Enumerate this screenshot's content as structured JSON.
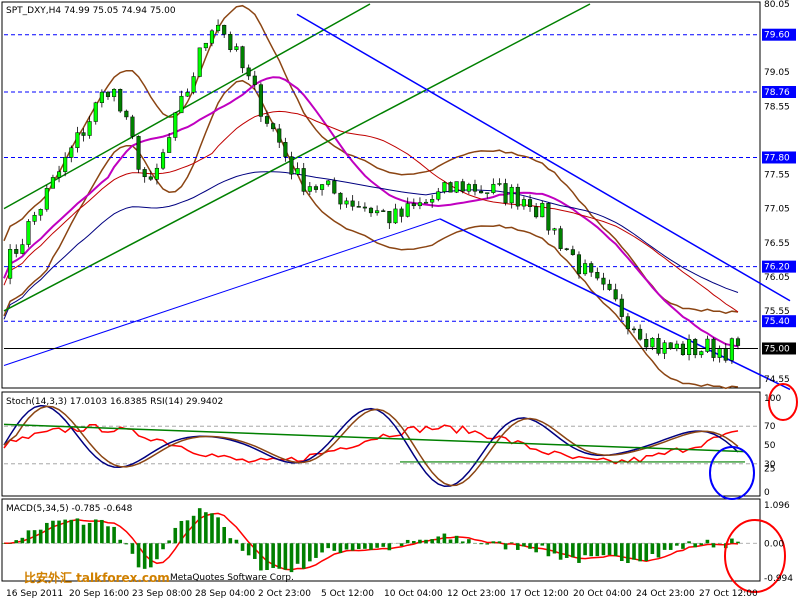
{
  "symbol_header": "SPT_DXY,H4  74.99 75.05 74.94 75.00",
  "stoch_header": "Stoch(14,3,3) 17.0103 16.8385  RSI(14) 29.9402",
  "macd_header": "MACD(5,34,5) -0.785 -0.648",
  "watermark": "比安外汇 talkforex.com",
  "footer_copyright": "MetaQuotes Software Corp.",
  "colors": {
    "background": "#ffffff",
    "bull_candle": "#00ff00",
    "bear_candle": "#008000",
    "dashed_level": "#0000ff",
    "level_tag": "#0000ff",
    "bollinger": "#8b4513",
    "ma_magenta": "#c000c0",
    "ma_red": "#c00000",
    "ma_navy": "#000080",
    "upper_channel": "#008000",
    "down_channel": "#0000ff",
    "stoch_main": "#000080",
    "stoch_signal": "#8b4513",
    "rsi": "#ff0000",
    "macd_hist": "#008000",
    "macd_signal": "#ff0000",
    "annotation_red": "#ff0000",
    "annotation_blue": "#0000ff",
    "watermark": "#d08000"
  },
  "price_axis": {
    "labels": [
      "80.05",
      "79.05",
      "78.55",
      "77.55",
      "77.05",
      "76.55",
      "76.05",
      "75.55",
      "74.55"
    ],
    "min": 74.45,
    "max": 80.05
  },
  "price_levels": [
    {
      "value": 79.6,
      "label": "79.60"
    },
    {
      "value": 78.76,
      "label": "78.76"
    },
    {
      "value": 77.8,
      "label": "77.80"
    },
    {
      "value": 76.2,
      "label": "76.20"
    },
    {
      "value": 75.4,
      "label": "75.40"
    },
    {
      "value": 75.0,
      "label": "75.00"
    }
  ],
  "stoch_axis": {
    "labels": [
      "100",
      "70",
      "50",
      "30",
      "25",
      "0"
    ],
    "levels": [
      100,
      70,
      50,
      30,
      25,
      0
    ]
  },
  "macd_axis": {
    "labels": [
      "1.096",
      "0.00",
      "-0.994"
    ],
    "max": 1.096,
    "min": -0.994
  },
  "time_axis": [
    "16 Sep 2011",
    "20 Sep 16:00",
    "23 Sep 08:00",
    "28 Sep 04:00",
    "2 Oct 23:00",
    "5 Oct 12:00",
    "10 Oct 04:00",
    "12 Oct 23:00",
    "17 Oct 12:00",
    "20 Oct 04:00",
    "24 Oct 23:00",
    "27 Oct 12:00"
  ],
  "chart_data": {
    "type": "candlestick",
    "symbol": "SPT_DXY",
    "timeframe": "H4",
    "last_bar": {
      "open": 74.99,
      "high": 75.05,
      "low": 74.94,
      "close": 75.0
    },
    "price_range": [
      74.45,
      80.05
    ],
    "key_points": [
      {
        "x": "16 Sep 2011",
        "price": 76.2
      },
      {
        "x": "23 Sep 08:00",
        "price": 78.9
      },
      {
        "x": "28 Sep 04:00",
        "price": 77.3
      },
      {
        "x": "2 Oct 23:00",
        "price": 79.9
      },
      {
        "x": "10 Oct 04:00",
        "price": 77.5
      },
      {
        "x": "12 Oct 23:00",
        "price": 76.9
      },
      {
        "x": "17 Oct 12:00",
        "price": 77.4
      },
      {
        "x": "20 Oct 04:00",
        "price": 77.2
      },
      {
        "x": "24 Oct 23:00",
        "price": 76.0
      },
      {
        "x": "27 Oct 12:00",
        "price": 75.0
      }
    ],
    "indicators": {
      "stochastic": {
        "params": "14,3,3",
        "main": 17.0103,
        "signal": 16.8385
      },
      "rsi": {
        "period": 14,
        "value": 29.9402
      },
      "macd": {
        "params": "5,34,5",
        "main": -0.785,
        "signal": -0.648
      }
    }
  }
}
